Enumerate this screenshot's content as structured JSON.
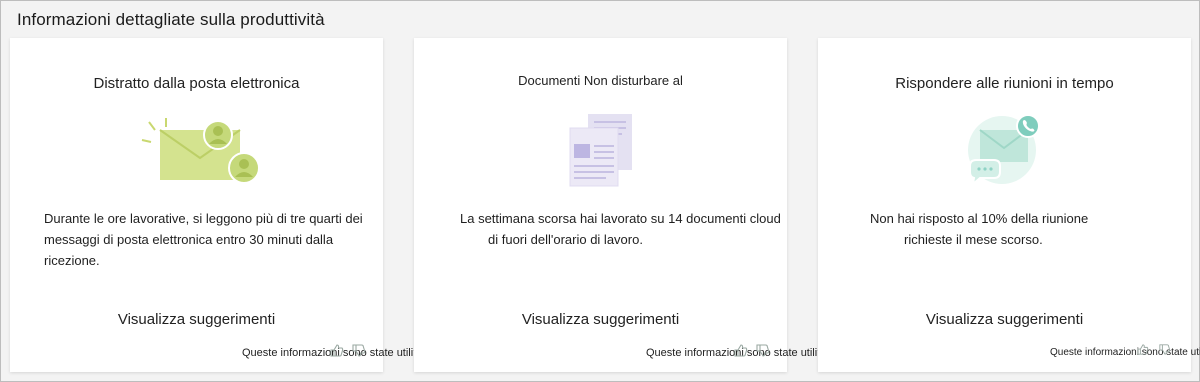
{
  "page": {
    "title": "Informazioni dettagliate sulla produttività"
  },
  "cards": [
    {
      "title": "Distratto dalla posta elettronica",
      "illustration": "email-distraction-icon",
      "body_line1": "Durante le ore lavorative, si leggono più di tre quarti dei",
      "body_line2": "messaggi di posta elettronica entro 30 minuti dalla ricezione.",
      "link": "Visualizza suggerimenti",
      "feedback": "Queste informazioni sono state utili?"
    },
    {
      "title": "Documenti Non disturbare al",
      "illustration": "documents-icon",
      "body_line1": "La settimana scorsa hai lavorato su 14 documenti cloud",
      "body_line2": "di fuori dell'orario di lavoro.",
      "link": "Visualizza suggerimenti",
      "feedback": "Queste informazioni sono state utili?"
    },
    {
      "title": "Rispondere alle riunioni in tempo",
      "illustration": "meeting-response-icon",
      "body_line1": "Non hai risposto al 10% della riunione",
      "body_line2": "richieste il mese scorso.",
      "link": "Visualizza suggerimenti",
      "feedback": "Queste informazioni sono state utili?"
    }
  ],
  "colors": {
    "email_green": "#cfe08a",
    "email_green_dark": "#b6cd5e",
    "doc_purple": "#c9c3e6",
    "teal": "#8fd3c5"
  }
}
